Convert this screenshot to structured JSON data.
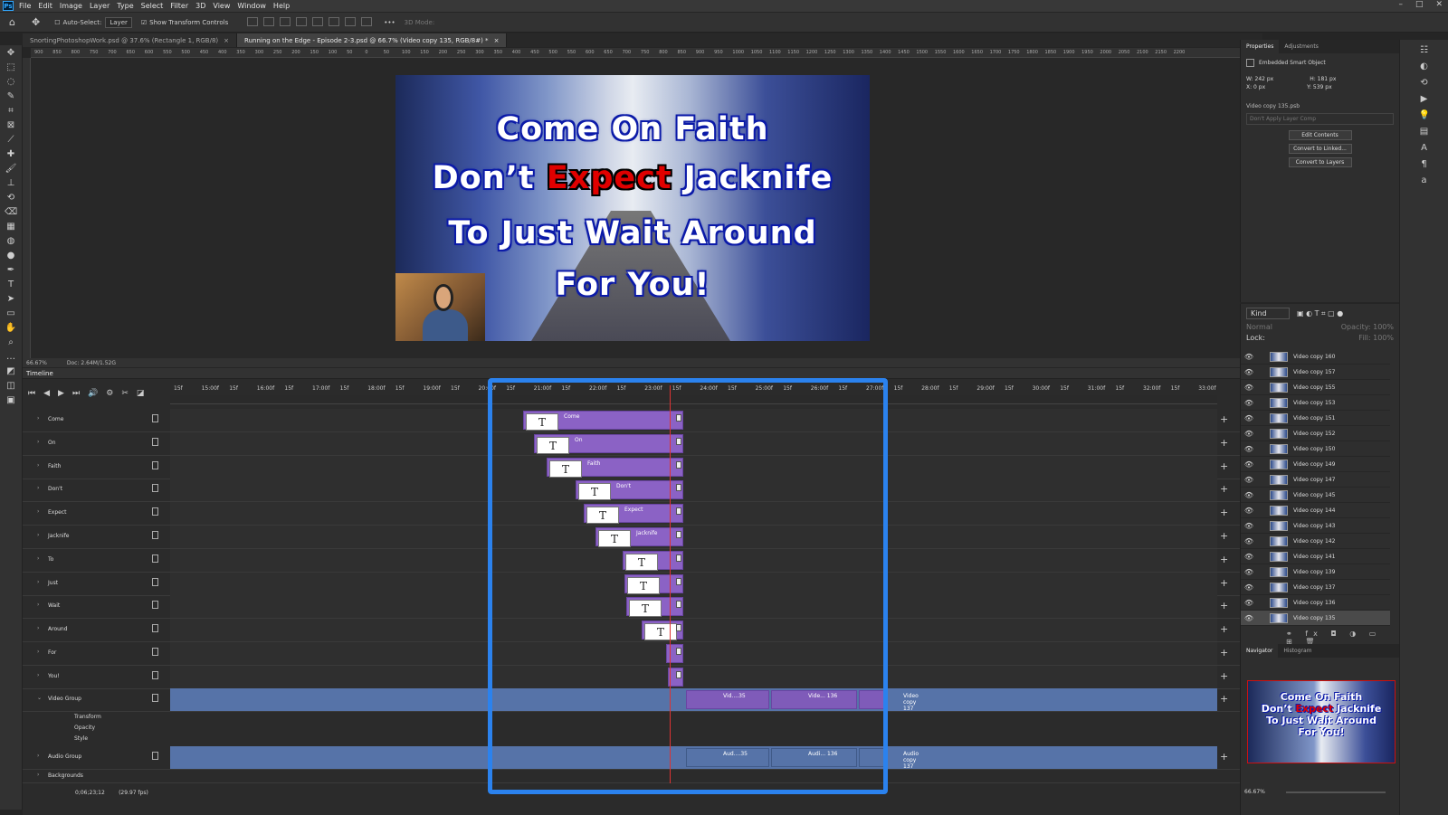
{
  "menubar": {
    "logo": "Ps",
    "items": [
      "File",
      "Edit",
      "Image",
      "Layer",
      "Type",
      "Select",
      "Filter",
      "3D",
      "View",
      "Window",
      "Help"
    ]
  },
  "options": {
    "auto_select": "Auto-Select:",
    "auto_select_value": "Layer",
    "show_transform": "Show Transform Controls",
    "mode_3d": "3D Mode:"
  },
  "tabs": [
    {
      "label": "SnortingPhotoshopWork.psd @ 37.6% (Rectangle 1, RGB/8)"
    },
    {
      "label": "Running on the Edge - Episode 2-3.psd @ 66.7% (Video copy 135, RGB/8#) *"
    }
  ],
  "ruler": [
    "900",
    "850",
    "800",
    "750",
    "700",
    "650",
    "600",
    "550",
    "500",
    "450",
    "400",
    "350",
    "300",
    "250",
    "200",
    "150",
    "100",
    "50",
    "0",
    "50",
    "100",
    "150",
    "200",
    "250",
    "300",
    "350",
    "400",
    "450",
    "500",
    "550",
    "600",
    "650",
    "700",
    "750",
    "800",
    "850",
    "900",
    "950",
    "1000",
    "1050",
    "1100",
    "1150",
    "1200",
    "1250",
    "1300",
    "1350",
    "1400",
    "1450",
    "1500",
    "1550",
    "1600",
    "1650",
    "1700",
    "1750",
    "1800",
    "1850",
    "1900",
    "1950",
    "2000",
    "2050",
    "2100",
    "2150",
    "2200"
  ],
  "canvas": {
    "line1": "Come On Faith",
    "line2_a": "Don’t ",
    "line2_red": "Expect",
    "line2_b": " Jacknife",
    "line3": "To Just Wait Around",
    "line4": "For You!"
  },
  "status": {
    "zoom": "66.67%",
    "doc": "Doc: 2.64M/1.52G"
  },
  "timeline": {
    "title": "Timeline",
    "ruler": [
      "15f",
      "15:00f",
      "15f",
      "16:00f",
      "15f",
      "17:00f",
      "15f",
      "18:00f",
      "15f",
      "19:00f",
      "15f",
      "20:00f",
      "15f",
      "21:00f",
      "15f",
      "22:00f",
      "15f",
      "23:00f",
      "15f",
      "24:00f",
      "15f",
      "25:00f",
      "15f",
      "26:00f",
      "15f",
      "27:00f",
      "15f",
      "28:00f",
      "15f",
      "29:00f",
      "15f",
      "30:00f",
      "15f",
      "31:00f",
      "15f",
      "32:00f",
      "15f",
      "33:00f"
    ],
    "layers": [
      "Come",
      "On",
      "Faith",
      "Don't",
      "Expect",
      "Jacknife",
      "To",
      "Just",
      "Wait",
      "Around",
      "For",
      "You!"
    ],
    "clip_labels": [
      "Come",
      "On",
      "Faith",
      "Don't",
      "Expect",
      "Jacknife",
      "",
      "",
      "",
      "",
      "",
      ""
    ],
    "clip_thumb": "T",
    "video_group": "Video Group",
    "transform": "Transform",
    "opacity": "Opacity",
    "style": "Style",
    "audio_group": "Audio Group",
    "backgrounds": "Backgrounds",
    "vid_clips": [
      "Vid....35",
      "Vide... 136",
      "Video copy 137"
    ],
    "aud_clips": [
      "Aud....35",
      "Audi... 136",
      "Audio copy 137"
    ],
    "timecode": "0;06;23;12",
    "fps": "(29.97 fps)"
  },
  "properties": {
    "tabs": [
      "Properties",
      "Adjustments"
    ],
    "type": "Embedded Smart Object",
    "w": "W: 242 px",
    "h": "H: 181 px",
    "x": "X: 0 px",
    "y": "Y: 539 px",
    "file": "Video copy 135.psb",
    "layer_comp": "Don't Apply Layer Comp",
    "buttons": [
      "Edit Contents",
      "Convert to Linked...",
      "Convert to Layers"
    ]
  },
  "layers_panel": {
    "kind": "Kind",
    "blend": "Normal",
    "opacity": "Opacity: 100%",
    "lock": "Lock:",
    "fill": "Fill: 100%",
    "items": [
      "Video copy 160",
      "Video copy 157",
      "Video copy 155",
      "Video copy 153",
      "Video copy 151",
      "Video copy 152",
      "Video copy 150",
      "Video copy 149",
      "Video copy 147",
      "Video copy 145",
      "Video copy 144",
      "Video copy 143",
      "Video copy 142",
      "Video copy 141",
      "Video copy 139",
      "Video copy 137",
      "Video copy 136",
      "Video copy 135"
    ]
  },
  "navigator": {
    "tabs": [
      "Navigator",
      "Histogram"
    ],
    "zoom": "66.67%",
    "l1": "Come On Faith",
    "l2a": "Don’t ",
    "l2r": "Expect",
    "l2b": " Jacknife",
    "l3": "To Just Wait Around",
    "l4": "For You!"
  },
  "colors": {
    "highlight": "#2b82ee",
    "clip": "#8b62c5",
    "group_track": "#5673a8",
    "caption_red": "#e00000"
  }
}
